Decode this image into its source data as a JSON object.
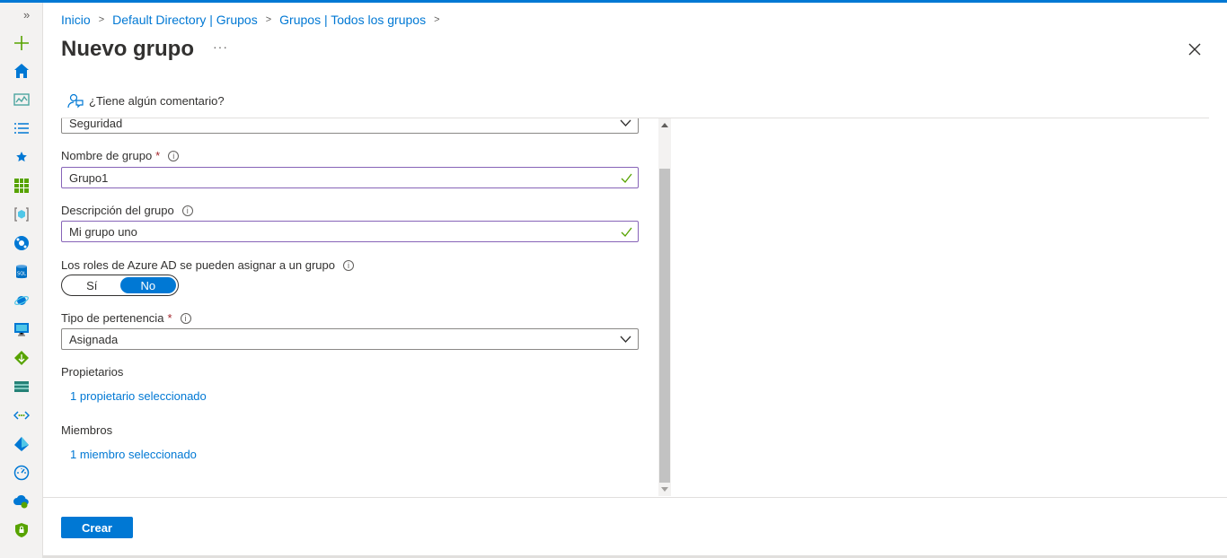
{
  "colors": {
    "accent": "#0078d4",
    "valid_border": "#8764b8",
    "check": "#57a300",
    "required": "#a4262c"
  },
  "sidebar": {
    "expand_icon": "double-chevron-right-icon",
    "items": [
      {
        "icon": "plus-icon",
        "color": "#57a300"
      },
      {
        "icon": "home-icon",
        "color": "#0078d4"
      },
      {
        "icon": "dashboard-icon",
        "color": "#4ca6a0"
      },
      {
        "icon": "all-services-list-icon",
        "color": "#0078d4"
      },
      {
        "icon": "favorites-star-icon",
        "color": "#0078d4"
      },
      {
        "icon": "all-resources-grid-icon",
        "color": "#57a300"
      },
      {
        "icon": "resource-groups-icon",
        "color": "#0078d4"
      },
      {
        "icon": "app-services-icon",
        "color": "#0078d4"
      },
      {
        "icon": "sql-database-icon",
        "color": "#0072c6"
      },
      {
        "icon": "cosmos-db-icon",
        "color": "#0078d4"
      },
      {
        "icon": "virtual-machine-icon",
        "color": "#0078d4"
      },
      {
        "icon": "load-balancer-icon",
        "color": "#57a300"
      },
      {
        "icon": "storage-account-icon",
        "color": "#258277"
      },
      {
        "icon": "virtual-network-icon",
        "color": "#0078d4"
      },
      {
        "icon": "azure-ad-icon",
        "color": "#0078d4"
      },
      {
        "icon": "monitor-icon",
        "color": "#0078d4"
      },
      {
        "icon": "advisor-icon",
        "color": "#0078d4"
      },
      {
        "icon": "security-center-icon",
        "color": "#57a300"
      }
    ]
  },
  "breadcrumb": [
    "Inicio",
    "Default Directory | Grupos",
    "Grupos | Todos los grupos"
  ],
  "header": {
    "title": "Nuevo grupo",
    "more": "···"
  },
  "commandbar": {
    "feedback": "¿Tiene algún comentario?"
  },
  "form": {
    "group_type": {
      "value": "Seguridad"
    },
    "group_name": {
      "label": "Nombre de grupo",
      "required_mark": "*",
      "value": "Grupo1",
      "info": "i"
    },
    "description": {
      "label": "Descripción del grupo",
      "value": "Mi grupo uno",
      "info": "i"
    },
    "roles": {
      "label": "Los roles de Azure AD se pueden asignar a un grupo",
      "info": "i",
      "yes": "Sí",
      "no": "No",
      "selected": "No"
    },
    "membership_type": {
      "label": "Tipo de pertenencia",
      "required_mark": "*",
      "value": "Asignada",
      "info": "i"
    },
    "owners": {
      "label": "Propietarios",
      "link": "1 propietario seleccionado"
    },
    "members": {
      "label": "Miembros",
      "link": "1 miembro seleccionado"
    }
  },
  "footer": {
    "create_label": "Crear"
  }
}
